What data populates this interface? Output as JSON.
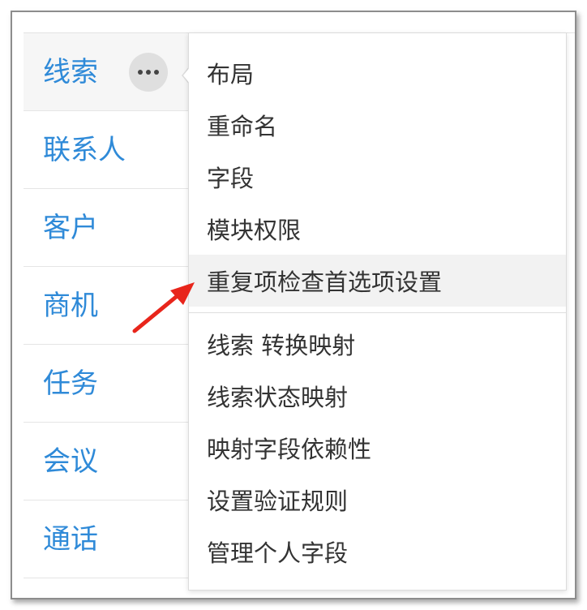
{
  "sidebar": {
    "items": [
      {
        "label": "线索"
      },
      {
        "label": "联系人"
      },
      {
        "label": "客户"
      },
      {
        "label": "商机"
      },
      {
        "label": "任务"
      },
      {
        "label": "会议"
      },
      {
        "label": "通话"
      }
    ]
  },
  "more_button": {
    "icon": "more-horizontal-icon"
  },
  "menu": {
    "items": [
      {
        "label": "布局"
      },
      {
        "label": "重命名"
      },
      {
        "label": "字段"
      },
      {
        "label": "模块权限"
      },
      {
        "label": "重复项检查首选项设置"
      },
      {
        "label": "线索 转换映射"
      },
      {
        "label": "线索状态映射"
      },
      {
        "label": "映射字段依赖性"
      },
      {
        "label": "设置验证规则"
      },
      {
        "label": "管理个人字段"
      }
    ]
  },
  "annotation": {
    "icon": "red-arrow-icon",
    "color": "#e8251b"
  },
  "colors": {
    "link": "#2f8ad8",
    "menu_text": "#333333",
    "highlight": "#f2f2f2"
  }
}
